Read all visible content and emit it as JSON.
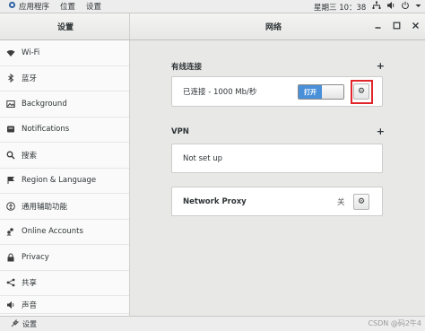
{
  "topbar": {
    "menus": [
      "应用程序",
      "位置",
      "设置"
    ],
    "clock": "星期三 10：38"
  },
  "header": {
    "left_title": "设置",
    "right_title": "网络"
  },
  "sidebar": {
    "items": [
      {
        "label": "Wi-Fi",
        "icon": "wifi-icon"
      },
      {
        "label": "蓝牙",
        "icon": "bluetooth-icon"
      },
      {
        "label": "Background",
        "icon": "background-icon"
      },
      {
        "label": "Notifications",
        "icon": "notifications-icon"
      },
      {
        "label": "搜索",
        "icon": "search-icon"
      },
      {
        "label": "Region & Language",
        "icon": "region-icon"
      },
      {
        "label": "通用辅助功能",
        "icon": "accessibility-icon"
      },
      {
        "label": "Online Accounts",
        "icon": "online-accounts-icon"
      },
      {
        "label": "Privacy",
        "icon": "privacy-icon"
      },
      {
        "label": "共享",
        "icon": "sharing-icon"
      },
      {
        "label": "声音",
        "icon": "sound-icon"
      }
    ]
  },
  "wired": {
    "heading": "有线连接",
    "status": "已连接 - 1000 Mb/秒",
    "toggle_label": "打开",
    "toggle_on": true
  },
  "vpn": {
    "heading": "VPN",
    "status": "Not set up"
  },
  "proxy": {
    "label": "Network Proxy",
    "state": "关"
  },
  "taskbar": {
    "item": "设置",
    "watermark": "CSDN @码2牛4"
  },
  "colors": {
    "accent": "#4a90d9",
    "highlight": "#e0252b"
  }
}
